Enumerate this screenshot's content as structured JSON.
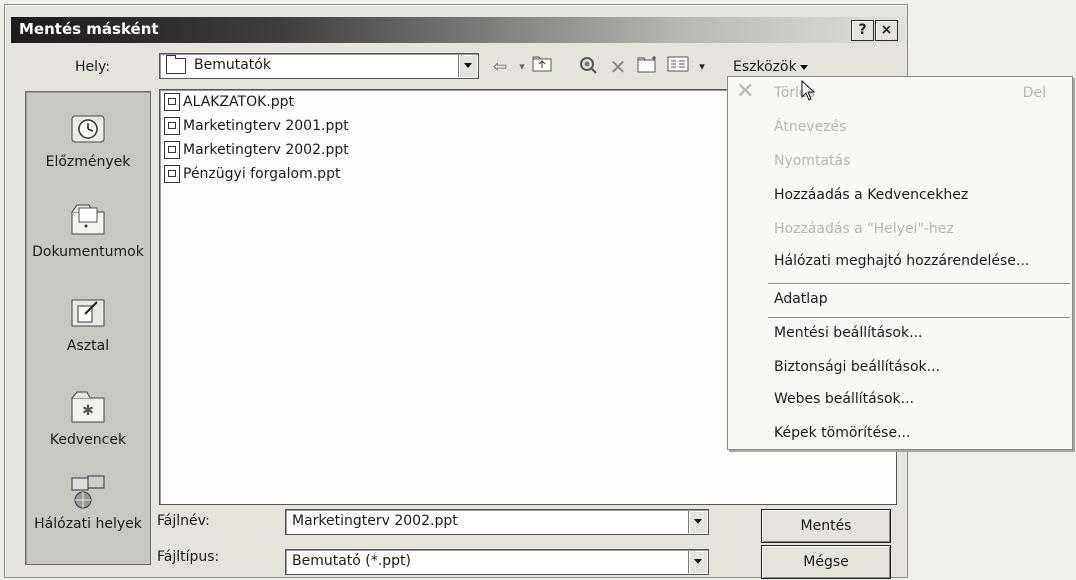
{
  "window": {
    "title": "Mentés másként",
    "help_label": "?",
    "close_label": "×"
  },
  "location": {
    "label": "Hely:",
    "value": "Bemutatók"
  },
  "toolbar": {
    "back_glyph": "⇦",
    "tools_label": "Eszközök"
  },
  "places": [
    {
      "label": "Előzmények",
      "icon": "history-icon"
    },
    {
      "label": "Dokumentumok",
      "icon": "documents-icon"
    },
    {
      "label": "Asztal",
      "icon": "desktop-icon"
    },
    {
      "label": "Kedvencek",
      "icon": "favorites-icon"
    },
    {
      "label": "Hálózati helyek",
      "icon": "network-places-icon"
    }
  ],
  "files": [
    "ALAKZATOK.ppt",
    "Marketingterv 2001.ppt",
    "Marketingterv 2002.ppt",
    "Pénzügyi forgalom.ppt"
  ],
  "filename": {
    "label": "Fájlnév:",
    "value": "Marketingterv 2002.ppt"
  },
  "filetype": {
    "label": "Fájltípus:",
    "value": "Bemutató (*.ppt)"
  },
  "buttons": {
    "save": "Mentés",
    "cancel": "Mégse"
  },
  "tools_menu": {
    "items": [
      {
        "label": "Törlés",
        "shortcut": "Del",
        "enabled": false
      },
      {
        "label": "Átnevezés",
        "enabled": false
      },
      {
        "label": "Nyomtatás",
        "enabled": false
      },
      {
        "label": "Hozzáadás a Kedvencekhez",
        "enabled": true
      },
      {
        "label": "Hozzáadás a \"Helyei\"-hez",
        "enabled": false
      },
      {
        "label": "Hálózati meghajtó hozzárendelése...",
        "enabled": true
      },
      {
        "label": "Adatlap",
        "enabled": true
      },
      {
        "label": "Mentési beállítások...",
        "enabled": true
      },
      {
        "label": "Biztonsági beállítások...",
        "enabled": true
      },
      {
        "label": "Webes beállítások...",
        "enabled": true
      },
      {
        "label": "Képek tömörítése...",
        "enabled": true
      }
    ]
  }
}
